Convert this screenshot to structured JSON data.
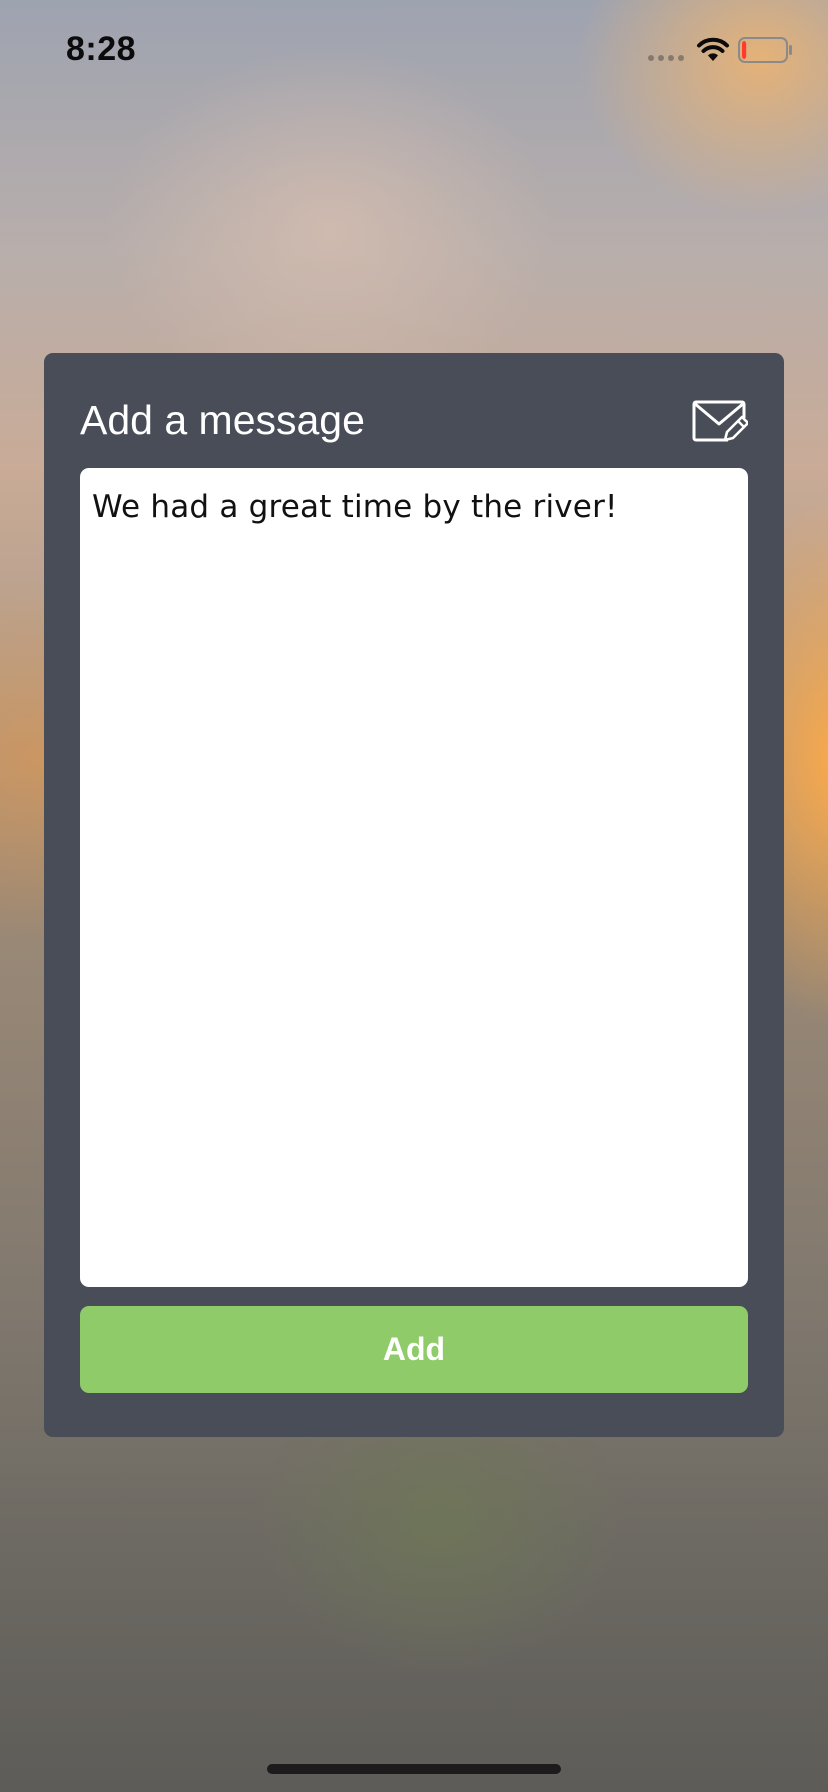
{
  "status_bar": {
    "time": "8:28",
    "battery_level": 0.1,
    "battery_color": "#ff3b30",
    "icons": [
      "signal-dots-icon",
      "wifi-icon",
      "battery-icon"
    ]
  },
  "dialog": {
    "title": "Add a message",
    "title_icon": "compose-envelope-icon",
    "message_text": "We had a great time by the river!",
    "add_label": "Add",
    "colors": {
      "panel": "#484d58",
      "button": "#8fcb69",
      "text_box": "#ffffff"
    }
  }
}
